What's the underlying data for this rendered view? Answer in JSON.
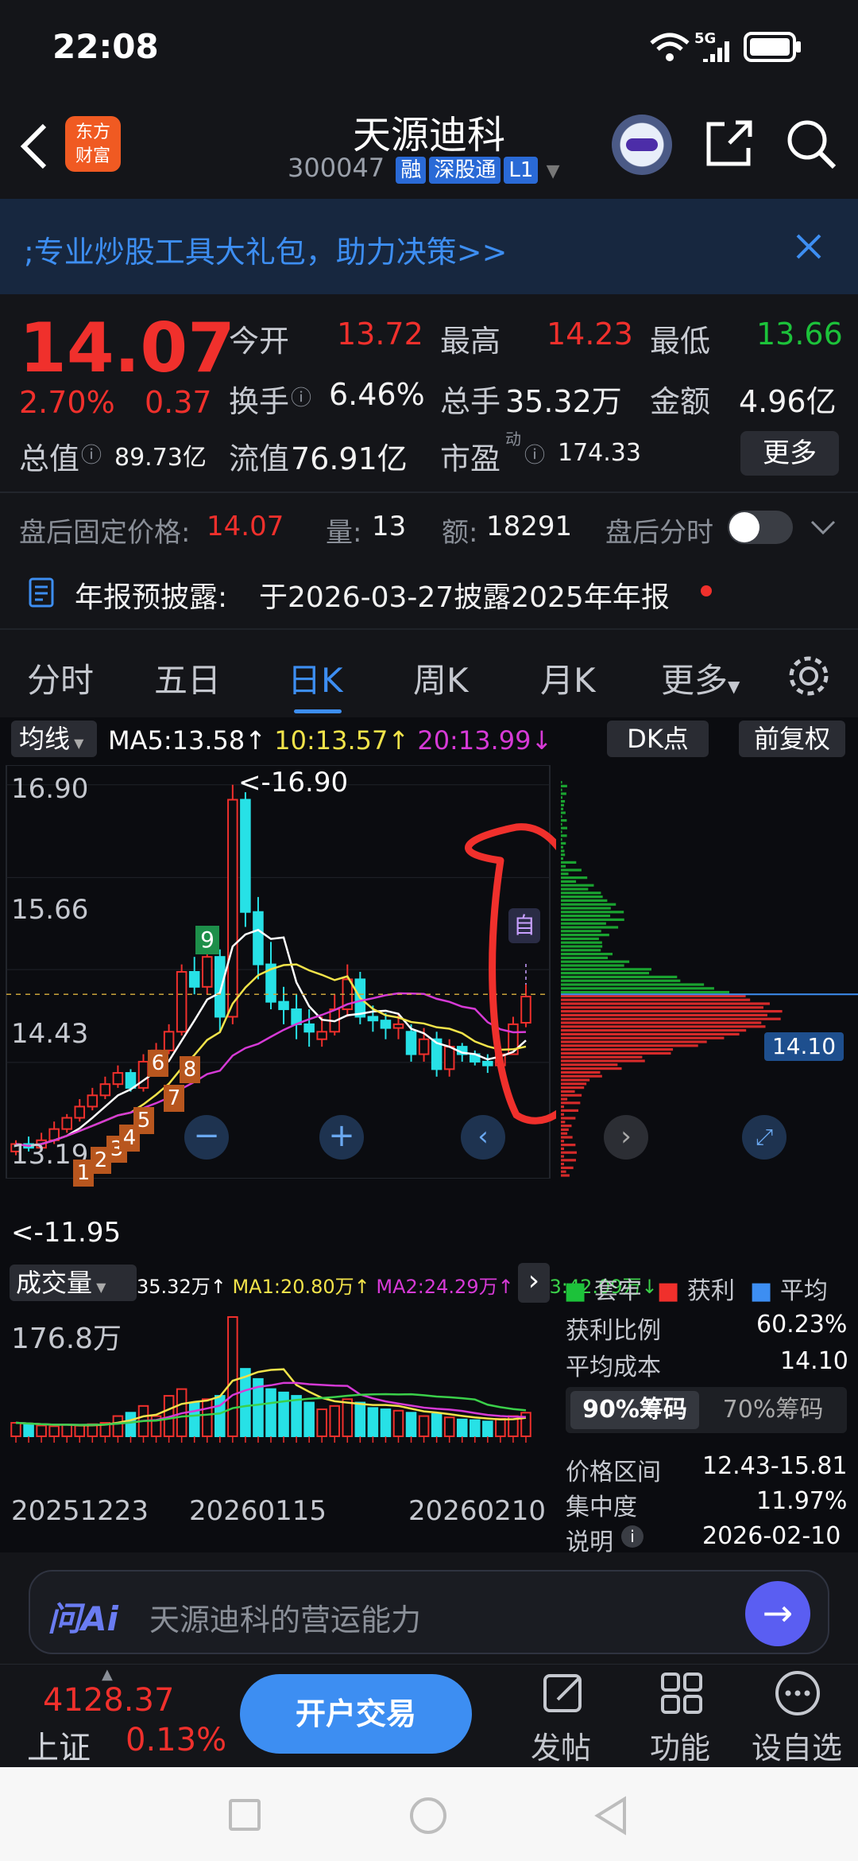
{
  "status_bar": {
    "time": "22:08",
    "network": "5G"
  },
  "header": {
    "title": "天源迪科",
    "code": "300047",
    "tags": [
      "融",
      "深股通",
      "L1"
    ],
    "logo_text": [
      "东方",
      "财富"
    ]
  },
  "banner": {
    "text": ";专业炒股工具大礼包，助力决策>>"
  },
  "quote": {
    "price": "14.07",
    "change_pct": "2.70%",
    "change": "0.37",
    "open_label": "今开",
    "open": "13.72",
    "high_label": "最高",
    "high": "14.23",
    "low_label": "最低",
    "low": "13.66",
    "turnover_label": "换手",
    "turnover": "6.46%",
    "volume_label": "总手",
    "volume": "35.32万",
    "amount_label": "金额",
    "amount": "4.96亿",
    "mktcap_label": "总值",
    "mktcap": "89.73亿",
    "float_label": "流值",
    "float": "76.91亿",
    "pe_label": "市盈",
    "pe_sup": "动",
    "pe": "174.33",
    "more": "更多"
  },
  "after_hours": {
    "label": "盘后固定价格:",
    "price": "14.07",
    "vol_label": "量:",
    "vol": "13",
    "amt_label": "额:",
    "amt": "18291",
    "toggle_label": "盘后分时"
  },
  "notice": {
    "label": "年报预披露:",
    "text": "于2026-03-27披露2025年年报"
  },
  "tabs": [
    {
      "label": "分时"
    },
    {
      "label": "五日"
    },
    {
      "label": "日K"
    },
    {
      "label": "周K"
    },
    {
      "label": "月K"
    },
    {
      "label": "更多"
    }
  ],
  "ma_bar": {
    "select": "均线",
    "ma5": "MA5:13.58",
    "ma10": "10:13.57",
    "ma20": "20:13.99",
    "dk": "DK点",
    "adjust": "前复权"
  },
  "kline": {
    "y_labels": [
      "16.90",
      "15.66",
      "14.43",
      "13.19",
      "11.95"
    ],
    "high_marker": "<-16.90",
    "low_marker": "<-11.95",
    "auto": "自",
    "td_numbers": [
      "1",
      "2",
      "3",
      "4",
      "5",
      "6",
      "7",
      "8",
      "9"
    ],
    "price_tag": "14.10"
  },
  "kline_candles": [
    {
      "o": 12.0,
      "c": 12.1,
      "h": 12.15,
      "l": 11.95
    },
    {
      "o": 12.1,
      "c": 12.05,
      "h": 12.2,
      "l": 12.0
    },
    {
      "o": 12.05,
      "c": 12.15,
      "h": 12.25,
      "l": 12.0
    },
    {
      "o": 12.15,
      "c": 12.3,
      "h": 12.4,
      "l": 12.1
    },
    {
      "o": 12.3,
      "c": 12.45,
      "h": 12.5,
      "l": 12.25
    },
    {
      "o": 12.45,
      "c": 12.6,
      "h": 12.7,
      "l": 12.4
    },
    {
      "o": 12.6,
      "c": 12.75,
      "h": 12.85,
      "l": 12.55
    },
    {
      "o": 12.75,
      "c": 12.9,
      "h": 13.0,
      "l": 12.7
    },
    {
      "o": 12.9,
      "c": 13.05,
      "h": 13.15,
      "l": 12.85
    },
    {
      "o": 13.05,
      "c": 12.85,
      "h": 13.1,
      "l": 12.8
    },
    {
      "o": 12.85,
      "c": 13.2,
      "h": 13.3,
      "l": 12.8
    },
    {
      "o": 13.2,
      "c": 13.35,
      "h": 13.45,
      "l": 13.1
    },
    {
      "o": 13.35,
      "c": 13.6,
      "h": 13.7,
      "l": 13.3
    },
    {
      "o": 13.6,
      "c": 14.4,
      "h": 14.5,
      "l": 13.55
    },
    {
      "o": 14.4,
      "c": 14.2,
      "h": 14.6,
      "l": 14.1
    },
    {
      "o": 14.2,
      "c": 14.6,
      "h": 14.75,
      "l": 14.1
    },
    {
      "o": 14.6,
      "c": 13.8,
      "h": 14.7,
      "l": 13.6
    },
    {
      "o": 13.8,
      "c": 16.7,
      "h": 16.9,
      "l": 13.7
    },
    {
      "o": 16.7,
      "c": 15.2,
      "h": 16.8,
      "l": 15.0
    },
    {
      "o": 15.2,
      "c": 14.5,
      "h": 15.4,
      "l": 14.3
    },
    {
      "o": 14.5,
      "c": 14.0,
      "h": 14.8,
      "l": 13.9
    },
    {
      "o": 14.0,
      "c": 13.9,
      "h": 14.2,
      "l": 13.7
    },
    {
      "o": 13.9,
      "c": 13.7,
      "h": 14.1,
      "l": 13.5
    },
    {
      "o": 13.7,
      "c": 13.6,
      "h": 13.9,
      "l": 13.4
    },
    {
      "o": 13.5,
      "c": 13.6,
      "h": 13.8,
      "l": 13.4
    },
    {
      "o": 13.6,
      "c": 13.9,
      "h": 14.1,
      "l": 13.55
    },
    {
      "o": 13.9,
      "c": 14.3,
      "h": 14.5,
      "l": 13.8
    },
    {
      "o": 14.3,
      "c": 13.8,
      "h": 14.4,
      "l": 13.7
    },
    {
      "o": 13.8,
      "c": 13.75,
      "h": 13.95,
      "l": 13.6
    },
    {
      "o": 13.75,
      "c": 13.65,
      "h": 13.85,
      "l": 13.5
    },
    {
      "o": 13.65,
      "c": 13.7,
      "h": 13.85,
      "l": 13.5
    },
    {
      "o": 13.6,
      "c": 13.3,
      "h": 13.7,
      "l": 13.2
    },
    {
      "o": 13.3,
      "c": 13.5,
      "h": 13.65,
      "l": 13.2
    },
    {
      "o": 13.5,
      "c": 13.1,
      "h": 13.6,
      "l": 13.0
    },
    {
      "o": 13.1,
      "c": 13.4,
      "h": 13.5,
      "l": 13.0
    },
    {
      "o": 13.4,
      "c": 13.3,
      "h": 13.45,
      "l": 13.2
    },
    {
      "o": 13.3,
      "c": 13.2,
      "h": 13.35,
      "l": 13.15
    },
    {
      "o": 13.2,
      "c": 13.15,
      "h": 13.3,
      "l": 13.05
    },
    {
      "o": 13.15,
      "c": 13.3,
      "h": 13.4,
      "l": 13.1
    },
    {
      "o": 13.3,
      "c": 13.7,
      "h": 13.8,
      "l": 13.66
    },
    {
      "o": 13.72,
      "c": 14.07,
      "h": 14.23,
      "l": 13.66
    }
  ],
  "volume": {
    "select": "成交量",
    "vol": "35.32万",
    "ma1": "MA1:20.80万",
    "ma2": "MA2:24.29万",
    "ma3": "MA3:42.09万",
    "max": "176.8万",
    "dates": [
      "20251223",
      "20260115",
      "20260210"
    ]
  },
  "volumes": [
    20,
    18,
    16,
    15,
    17,
    16,
    18,
    20,
    30,
    35,
    45,
    30,
    60,
    70,
    50,
    55,
    60,
    176.8,
    100,
    85,
    70,
    65,
    60,
    50,
    40,
    45,
    55,
    50,
    42,
    40,
    38,
    35,
    30,
    33,
    28,
    25,
    24,
    22,
    26,
    30,
    35
  ],
  "chips": {
    "legend": [
      "套牢",
      "获利",
      "平均"
    ],
    "profit_label": "获利比例",
    "profit": "60.23%",
    "avg_label": "平均成本",
    "avg": "14.10",
    "tab90": "90%筹码",
    "tab70": "70%筹码",
    "range_label": "价格区间",
    "range": "12.43-15.81",
    "conc_label": "集中度",
    "conc": "11.97%",
    "note_label": "说明",
    "note": "2026-02-10"
  },
  "ask": {
    "brand": "问Ai",
    "placeholder": "天源迪科的营运能力"
  },
  "bottom": {
    "index_value": "4128.37",
    "index_name": "上证",
    "index_pct": "0.13%",
    "trade": "开户交易",
    "post": "发帖",
    "func": "功能",
    "watch": "设自选"
  },
  "colors": {
    "up": "#f0302c",
    "down": "#1cc23a",
    "accent": "#3d8ef2",
    "bg": "#0d0f14"
  }
}
